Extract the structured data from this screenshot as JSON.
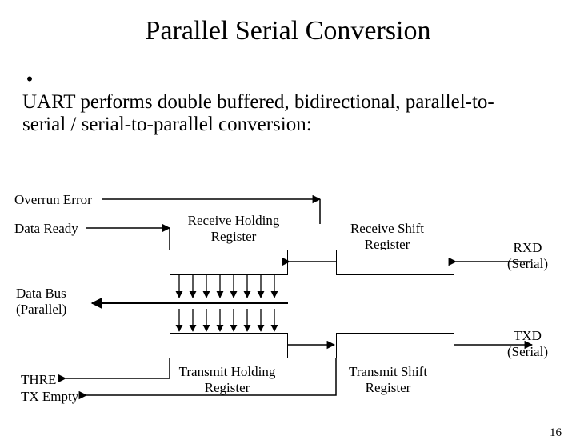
{
  "title": "Parallel Serial Conversion",
  "bullet_text": "UART performs double buffered, bidirectional, parallel-to-serial / serial-to-parallel conversion:",
  "labels": {
    "overrun_error": "Overrun Error",
    "data_ready": "Data Ready",
    "data_bus": "Data Bus\n(Parallel)",
    "thre": "THRE",
    "tx_empty": "TX Empty",
    "receive_holding": "Receive Holding\nRegister",
    "receive_shift": "Receive Shift\nRegister",
    "rxd": "RXD\n(Serial)",
    "transmit_holding": "Transmit Holding\nRegister",
    "transmit_shift": "Transmit Shift\nRegister",
    "txd": "TXD\n(Serial)"
  },
  "page_number": "16"
}
